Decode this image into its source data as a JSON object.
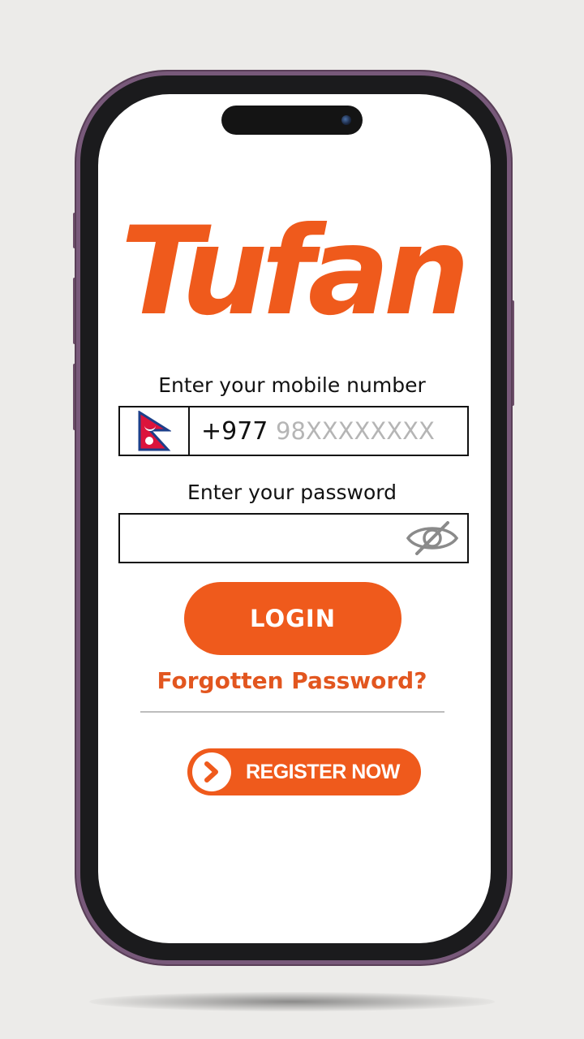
{
  "brand": {
    "logo_text": "Tufan",
    "accent_color": "#ef5a1c"
  },
  "mobile": {
    "label": "Enter your mobile number",
    "country_flag": "nepal-flag-icon",
    "country_code": "+977",
    "placeholder": "98XXXXXXXX",
    "value": ""
  },
  "password": {
    "label": "Enter your password",
    "value": "",
    "toggle_icon": "eye-off-icon"
  },
  "actions": {
    "login_label": "LOGIN",
    "forgot_label": "Forgotten Password?",
    "register_label": "REGISTER NOW",
    "register_icon": "chevron-right-icon"
  }
}
